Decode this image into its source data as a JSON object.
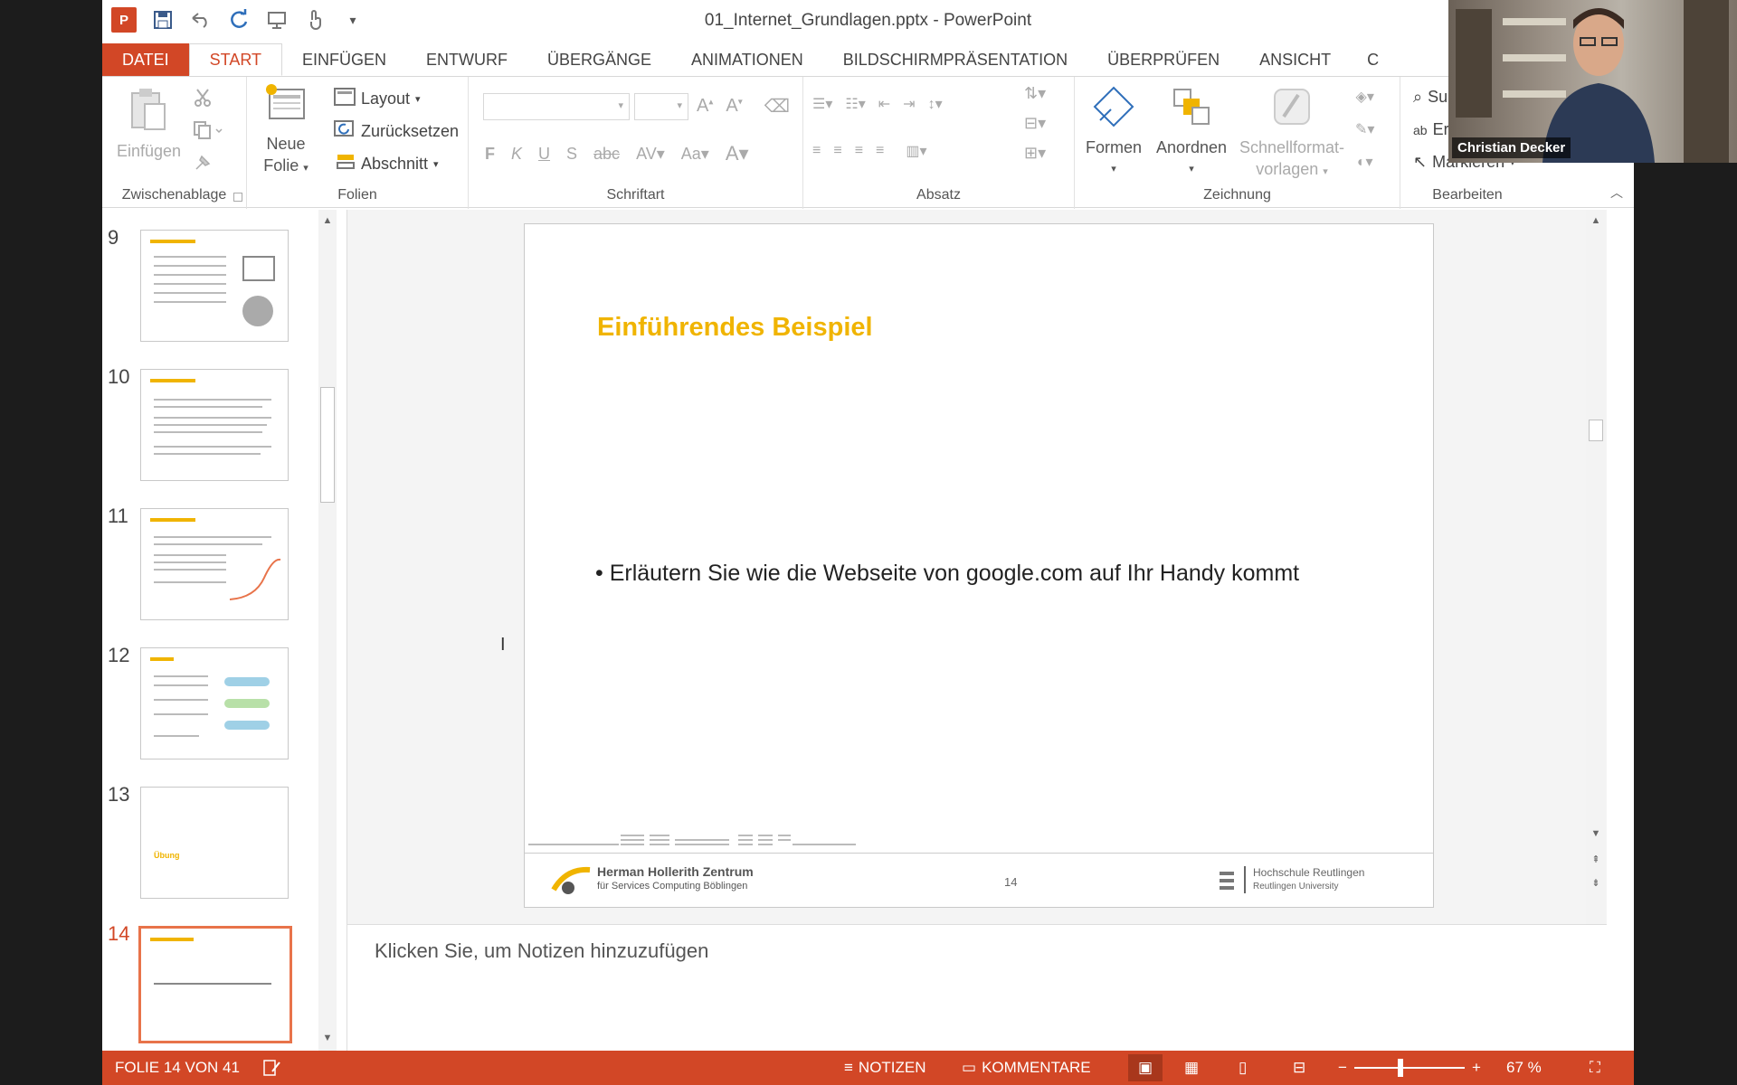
{
  "window": {
    "title": "01_Internet_Grundlagen.pptx - PowerPoint"
  },
  "app_logo": "P",
  "qat_icons": [
    "save-icon",
    "undo-icon",
    "redo-icon",
    "present-icon",
    "touch-icon",
    "customize-icon"
  ],
  "tabs": [
    {
      "label": "DATEI"
    },
    {
      "label": "START"
    },
    {
      "label": "EINFÜGEN"
    },
    {
      "label": "ENTWURF"
    },
    {
      "label": "ÜBERGÄNGE"
    },
    {
      "label": "ANIMATIONEN"
    },
    {
      "label": "BILDSCHIRMPRÄSENTATION"
    },
    {
      "label": "ÜBERPRÜFEN"
    },
    {
      "label": "ANSICHT"
    }
  ],
  "tabs_cut": "C",
  "ribbon": {
    "clipboard": {
      "label": "Zwischenablage",
      "paste": "Einfügen"
    },
    "slides": {
      "label": "Folien",
      "new_slide_1": "Neue",
      "new_slide_2": "Folie",
      "layout": "Layout",
      "reset": "Zurücksetzen",
      "section": "Abschnitt"
    },
    "font": {
      "label": "Schriftart"
    },
    "paragraph": {
      "label": "Absatz"
    },
    "drawing": {
      "label": "Zeichnung",
      "shapes": "Formen",
      "arrange": "Anordnen",
      "quickstyles_1": "Schnellformat-",
      "quickstyles_2": "vorlagen"
    },
    "editing": {
      "label": "Bearbeiten",
      "find": "Su",
      "replace": "Er",
      "select": "Markieren"
    }
  },
  "thumbnails": [
    {
      "num": "9"
    },
    {
      "num": "10"
    },
    {
      "num": "11"
    },
    {
      "num": "12"
    },
    {
      "num": "13"
    },
    {
      "num": "14"
    }
  ],
  "selected_thumb_index": 5,
  "slide": {
    "title": "Einführendes Beispiel",
    "bullet": "• Erläutern Sie wie die Webseite von google.com auf Ihr Handy kommt",
    "page_number": "14",
    "footer_left_1": "Herman Hollerith Zentrum",
    "footer_left_2": "für Services Computing Böblingen",
    "footer_right_1": "Hochschule Reutlingen",
    "footer_right_2": "Reutlingen University",
    "title_color": "#F0B400"
  },
  "thumb13_title": "Übung",
  "notes": {
    "placeholder": "Klicken Sie, um Notizen hinzuzufügen"
  },
  "status": {
    "slide_info": "FOLIE 14 VON 41",
    "notes": "NOTIZEN",
    "comments": "KOMMENTARE",
    "zoom": "67 %"
  },
  "webcam": {
    "name": "Christian Decker"
  },
  "colors": {
    "accent": "#D24726"
  }
}
